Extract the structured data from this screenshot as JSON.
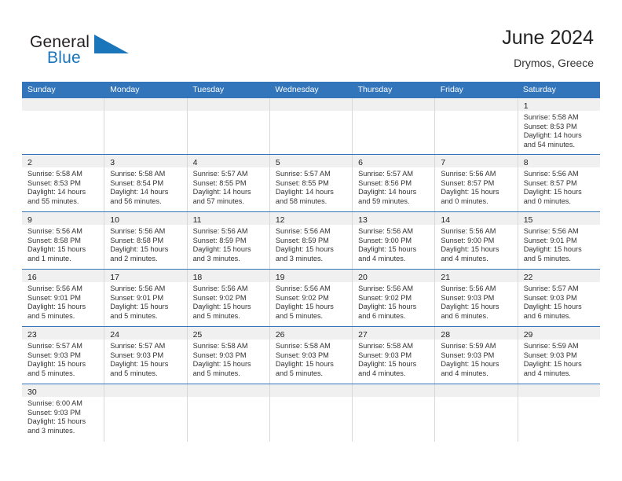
{
  "logo": {
    "word_top": "General",
    "word_bottom": "Blue",
    "triangle_icon": "blue-triangle-icon"
  },
  "header": {
    "title": "June 2024",
    "subtitle": "Drymos, Greece"
  },
  "colors": {
    "header_blue": "#3275bb",
    "row_divider_blue": "#3275bb",
    "daynum_band": "#f0f0f0",
    "logo_blue": "#1b75bb",
    "text": "#333333"
  },
  "calendar": {
    "weekdays": [
      "Sunday",
      "Monday",
      "Tuesday",
      "Wednesday",
      "Thursday",
      "Friday",
      "Saturday"
    ],
    "weeks": [
      [
        {
          "empty": true
        },
        {
          "empty": true
        },
        {
          "empty": true
        },
        {
          "empty": true
        },
        {
          "empty": true
        },
        {
          "empty": true
        },
        {
          "day": "1",
          "sunrise": "Sunrise: 5:58 AM",
          "sunset": "Sunset: 8:53 PM",
          "daylight1": "Daylight: 14 hours",
          "daylight2": "and 54 minutes."
        }
      ],
      [
        {
          "day": "2",
          "sunrise": "Sunrise: 5:58 AM",
          "sunset": "Sunset: 8:53 PM",
          "daylight1": "Daylight: 14 hours",
          "daylight2": "and 55 minutes."
        },
        {
          "day": "3",
          "sunrise": "Sunrise: 5:58 AM",
          "sunset": "Sunset: 8:54 PM",
          "daylight1": "Daylight: 14 hours",
          "daylight2": "and 56 minutes."
        },
        {
          "day": "4",
          "sunrise": "Sunrise: 5:57 AM",
          "sunset": "Sunset: 8:55 PM",
          "daylight1": "Daylight: 14 hours",
          "daylight2": "and 57 minutes."
        },
        {
          "day": "5",
          "sunrise": "Sunrise: 5:57 AM",
          "sunset": "Sunset: 8:55 PM",
          "daylight1": "Daylight: 14 hours",
          "daylight2": "and 58 minutes."
        },
        {
          "day": "6",
          "sunrise": "Sunrise: 5:57 AM",
          "sunset": "Sunset: 8:56 PM",
          "daylight1": "Daylight: 14 hours",
          "daylight2": "and 59 minutes."
        },
        {
          "day": "7",
          "sunrise": "Sunrise: 5:56 AM",
          "sunset": "Sunset: 8:57 PM",
          "daylight1": "Daylight: 15 hours",
          "daylight2": "and 0 minutes."
        },
        {
          "day": "8",
          "sunrise": "Sunrise: 5:56 AM",
          "sunset": "Sunset: 8:57 PM",
          "daylight1": "Daylight: 15 hours",
          "daylight2": "and 0 minutes."
        }
      ],
      [
        {
          "day": "9",
          "sunrise": "Sunrise: 5:56 AM",
          "sunset": "Sunset: 8:58 PM",
          "daylight1": "Daylight: 15 hours",
          "daylight2": "and 1 minute."
        },
        {
          "day": "10",
          "sunrise": "Sunrise: 5:56 AM",
          "sunset": "Sunset: 8:58 PM",
          "daylight1": "Daylight: 15 hours",
          "daylight2": "and 2 minutes."
        },
        {
          "day": "11",
          "sunrise": "Sunrise: 5:56 AM",
          "sunset": "Sunset: 8:59 PM",
          "daylight1": "Daylight: 15 hours",
          "daylight2": "and 3 minutes."
        },
        {
          "day": "12",
          "sunrise": "Sunrise: 5:56 AM",
          "sunset": "Sunset: 8:59 PM",
          "daylight1": "Daylight: 15 hours",
          "daylight2": "and 3 minutes."
        },
        {
          "day": "13",
          "sunrise": "Sunrise: 5:56 AM",
          "sunset": "Sunset: 9:00 PM",
          "daylight1": "Daylight: 15 hours",
          "daylight2": "and 4 minutes."
        },
        {
          "day": "14",
          "sunrise": "Sunrise: 5:56 AM",
          "sunset": "Sunset: 9:00 PM",
          "daylight1": "Daylight: 15 hours",
          "daylight2": "and 4 minutes."
        },
        {
          "day": "15",
          "sunrise": "Sunrise: 5:56 AM",
          "sunset": "Sunset: 9:01 PM",
          "daylight1": "Daylight: 15 hours",
          "daylight2": "and 5 minutes."
        }
      ],
      [
        {
          "day": "16",
          "sunrise": "Sunrise: 5:56 AM",
          "sunset": "Sunset: 9:01 PM",
          "daylight1": "Daylight: 15 hours",
          "daylight2": "and 5 minutes."
        },
        {
          "day": "17",
          "sunrise": "Sunrise: 5:56 AM",
          "sunset": "Sunset: 9:01 PM",
          "daylight1": "Daylight: 15 hours",
          "daylight2": "and 5 minutes."
        },
        {
          "day": "18",
          "sunrise": "Sunrise: 5:56 AM",
          "sunset": "Sunset: 9:02 PM",
          "daylight1": "Daylight: 15 hours",
          "daylight2": "and 5 minutes."
        },
        {
          "day": "19",
          "sunrise": "Sunrise: 5:56 AM",
          "sunset": "Sunset: 9:02 PM",
          "daylight1": "Daylight: 15 hours",
          "daylight2": "and 5 minutes."
        },
        {
          "day": "20",
          "sunrise": "Sunrise: 5:56 AM",
          "sunset": "Sunset: 9:02 PM",
          "daylight1": "Daylight: 15 hours",
          "daylight2": "and 6 minutes."
        },
        {
          "day": "21",
          "sunrise": "Sunrise: 5:56 AM",
          "sunset": "Sunset: 9:03 PM",
          "daylight1": "Daylight: 15 hours",
          "daylight2": "and 6 minutes."
        },
        {
          "day": "22",
          "sunrise": "Sunrise: 5:57 AM",
          "sunset": "Sunset: 9:03 PM",
          "daylight1": "Daylight: 15 hours",
          "daylight2": "and 6 minutes."
        }
      ],
      [
        {
          "day": "23",
          "sunrise": "Sunrise: 5:57 AM",
          "sunset": "Sunset: 9:03 PM",
          "daylight1": "Daylight: 15 hours",
          "daylight2": "and 5 minutes."
        },
        {
          "day": "24",
          "sunrise": "Sunrise: 5:57 AM",
          "sunset": "Sunset: 9:03 PM",
          "daylight1": "Daylight: 15 hours",
          "daylight2": "and 5 minutes."
        },
        {
          "day": "25",
          "sunrise": "Sunrise: 5:58 AM",
          "sunset": "Sunset: 9:03 PM",
          "daylight1": "Daylight: 15 hours",
          "daylight2": "and 5 minutes."
        },
        {
          "day": "26",
          "sunrise": "Sunrise: 5:58 AM",
          "sunset": "Sunset: 9:03 PM",
          "daylight1": "Daylight: 15 hours",
          "daylight2": "and 5 minutes."
        },
        {
          "day": "27",
          "sunrise": "Sunrise: 5:58 AM",
          "sunset": "Sunset: 9:03 PM",
          "daylight1": "Daylight: 15 hours",
          "daylight2": "and 4 minutes."
        },
        {
          "day": "28",
          "sunrise": "Sunrise: 5:59 AM",
          "sunset": "Sunset: 9:03 PM",
          "daylight1": "Daylight: 15 hours",
          "daylight2": "and 4 minutes."
        },
        {
          "day": "29",
          "sunrise": "Sunrise: 5:59 AM",
          "sunset": "Sunset: 9:03 PM",
          "daylight1": "Daylight: 15 hours",
          "daylight2": "and 4 minutes."
        }
      ],
      [
        {
          "day": "30",
          "sunrise": "Sunrise: 6:00 AM",
          "sunset": "Sunset: 9:03 PM",
          "daylight1": "Daylight: 15 hours",
          "daylight2": "and 3 minutes."
        },
        {
          "empty": true
        },
        {
          "empty": true
        },
        {
          "empty": true
        },
        {
          "empty": true
        },
        {
          "empty": true
        },
        {
          "empty": true
        }
      ]
    ]
  }
}
